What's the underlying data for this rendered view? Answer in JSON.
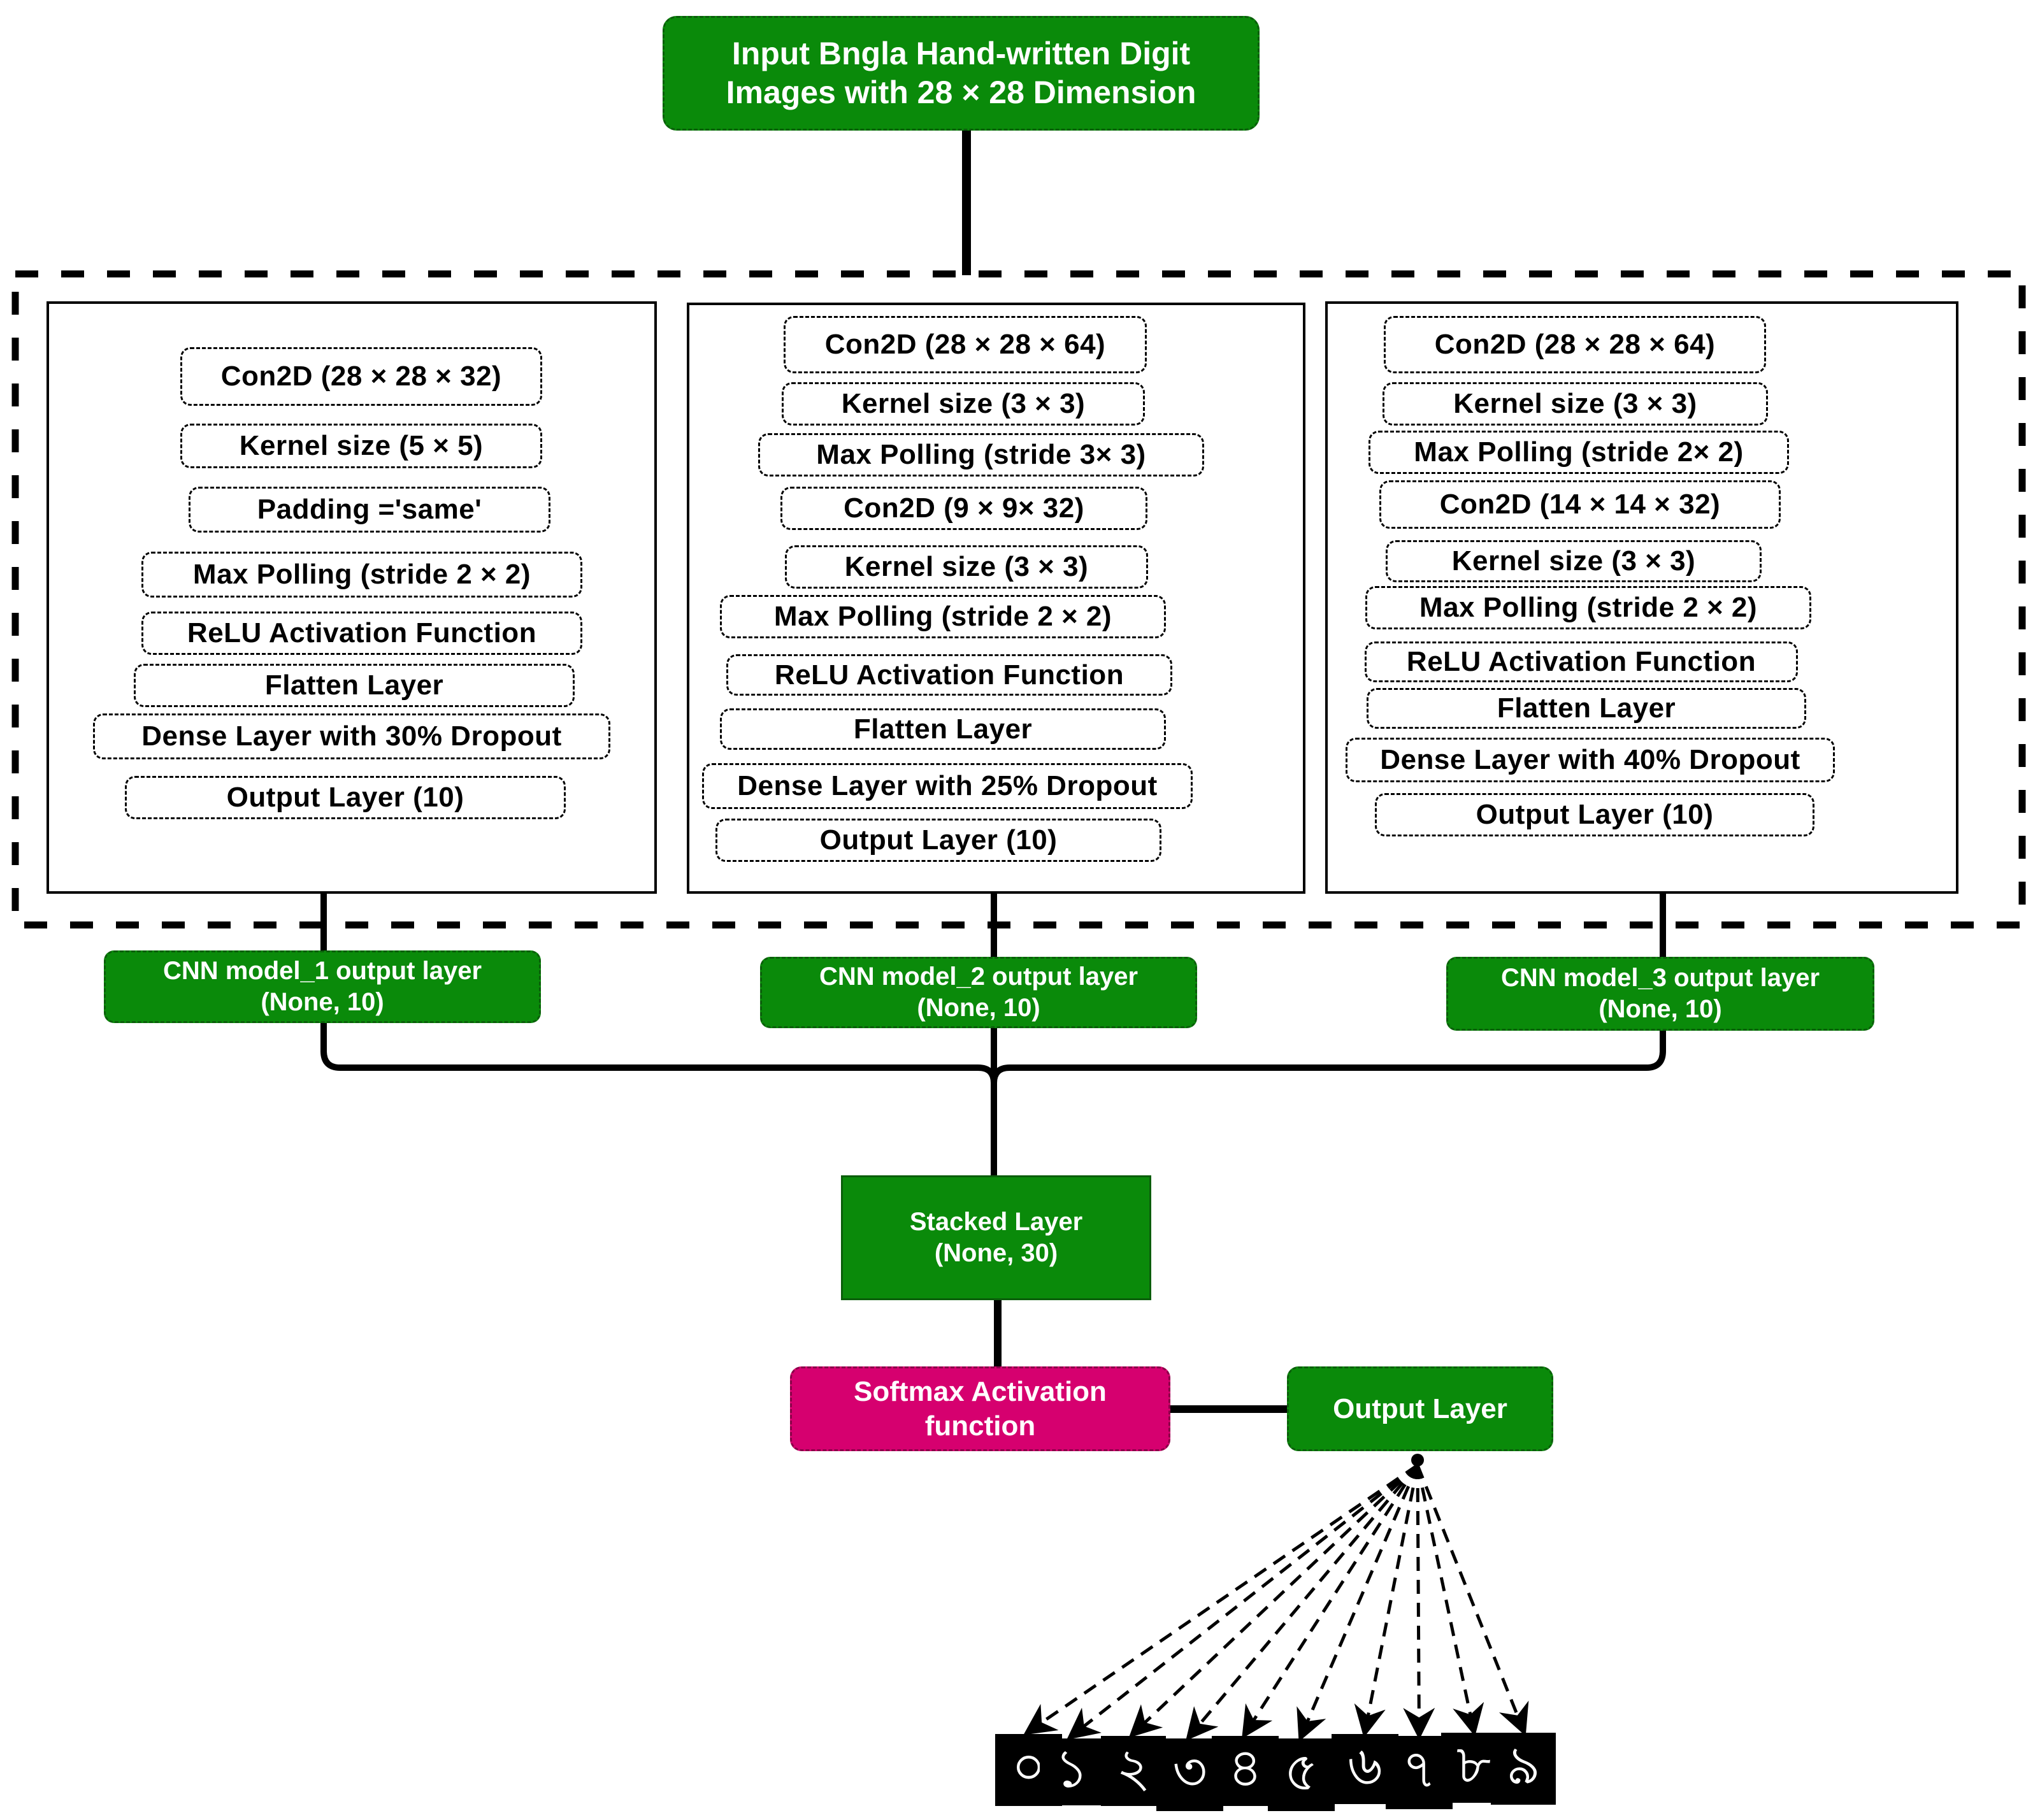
{
  "input": {
    "line1": "Input Bngla Hand-written Digit",
    "line2": "Images with 28 × 28 Dimension"
  },
  "models": [
    {
      "name": "CNN model_1",
      "layers": [
        "Con2D (28 × 28 × 32)",
        "Kernel size (5 × 5)",
        "Padding ='same'",
        "Max Polling (stride 2 × 2)",
        "ReLU Activation Function",
        "Flatten Layer",
        "Dense Layer with 30% Dropout",
        "Output Layer (10)"
      ],
      "output_line1": "CNN model_1 output layer",
      "output_line2": "(None, 10)"
    },
    {
      "name": "CNN model_2",
      "layers": [
        "Con2D (28 × 28 × 64)",
        "Kernel size (3 × 3)",
        "Max Polling (stride 3× 3)",
        "Con2D (9 × 9× 32)",
        "Kernel size (3 × 3)",
        "Max Polling (stride 2 × 2)",
        "ReLU Activation Function",
        "Flatten Layer",
        "Dense Layer with 25% Dropout",
        "Output Layer (10)"
      ],
      "output_line1": "CNN model_2 output layer",
      "output_line2": "(None, 10)"
    },
    {
      "name": "CNN model_3",
      "layers": [
        "Con2D (28 × 28 × 64)",
        "Kernel size (3 × 3)",
        "Max Polling (stride 2× 2)",
        "Con2D (14 × 14 × 32)",
        "Kernel size (3 × 3)",
        "Max Polling (stride 2 × 2)",
        "ReLU Activation Function",
        "Flatten Layer",
        "Dense Layer with 40% Dropout",
        "Output Layer (10)"
      ],
      "output_line1": "CNN model_3 output layer",
      "output_line2": "(None, 10)"
    }
  ],
  "stacked": {
    "line1": "Stacked Layer",
    "line2": "(None, 30)"
  },
  "softmax": {
    "line1": "Softmax Activation",
    "line2": "function"
  },
  "output": {
    "label": "Output Layer"
  },
  "digits": [
    "০",
    "১",
    "২",
    "৩",
    "৪",
    "৫",
    "৬",
    "৭",
    "৮",
    "৯"
  ],
  "colors": {
    "green": "#0a8a0a",
    "pink": "#d6006f",
    "line": "#000000"
  }
}
